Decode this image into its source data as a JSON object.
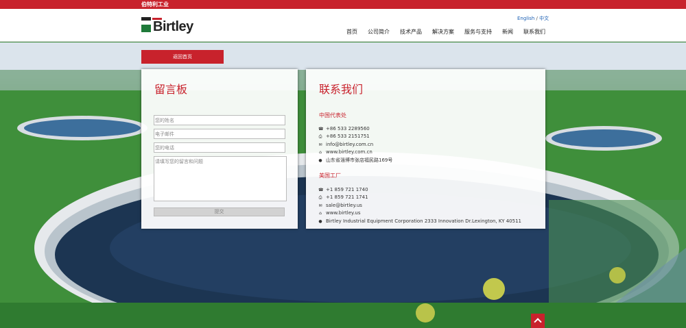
{
  "topbar": {
    "text": "伯特利工业"
  },
  "header": {
    "logo_text": "Birtley",
    "lang": {
      "english": "English",
      "sep": " / ",
      "chinese": "中文"
    },
    "nav": [
      "首页",
      "公司简介",
      "技术产品",
      "解决方案",
      "服务与支持",
      "新闻",
      "联系我们"
    ]
  },
  "home_button": "返回首页",
  "message_board": {
    "title": "留言板",
    "name_placeholder": "您的姓名",
    "email_placeholder": "电子邮件",
    "phone_placeholder": "您的电话",
    "message_placeholder": "请填写您的留言和问题",
    "submit_label": "提交"
  },
  "contact": {
    "title": "联系我们",
    "china": {
      "heading": "中国代表处",
      "phone": "+86 533 2289560",
      "fax": "+86 533 2151751",
      "email": "info@birtley.com.cn",
      "website": "www.birtley.com.cn",
      "address": "山东省淄博市张店福民路169号"
    },
    "usa": {
      "heading": "美国工厂",
      "phone": "+1 859 721 1740",
      "fax": "+1 859 721 1741",
      "email": "sale@birtley.us",
      "website": "www.birtley.us",
      "address": "Birtley Industrial Equipment Corporation 2333 Innovation Dr.Lexington, KY 40511"
    }
  },
  "colors": {
    "brand_red": "#c8222c",
    "brand_green": "#1f7a3a",
    "link_blue": "#1a5fb4"
  },
  "icons": [
    "phone-icon",
    "fax-icon",
    "email-icon",
    "home-icon",
    "location-icon",
    "arrow-up-icon"
  ]
}
